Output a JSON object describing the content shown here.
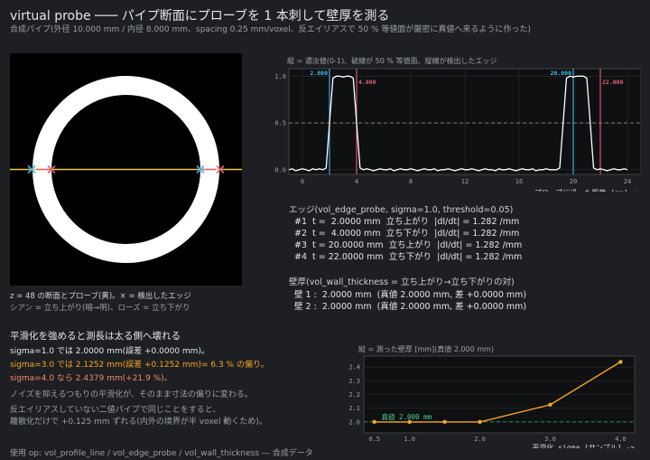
{
  "title": "virtual probe ─── パイプ断面にプローブを 1 本刺して壁厚を測る",
  "subtitle": "合成パイプ(外径 10.000 mm / 内径 8.000 mm、spacing 0.25 mm/voxel、反エイリアスで 50 % 等値面が厳密に真値へ来るように作った)",
  "slice": {
    "caption": "z = 48 の断面とプローブ(黄)。× = 検出したエッジ",
    "legend": "シアン = 立ち上がり(暗→明)、ローズ = 立ち下がり"
  },
  "colors": {
    "background": "#1e1f22",
    "plot_bg": "#0f1012",
    "probe": "#f2c94c",
    "rising": "#3fb8ea",
    "falling": "#e2607a",
    "profile": "#ffffff",
    "threshold": "#8a8d92",
    "thickness_line": "#f5a623",
    "truth_line": "#2f9e6b",
    "accent_text": "#f5a623",
    "accent_red": "#f08a6c"
  },
  "chart_data": [
    {
      "type": "line",
      "title": "縦 = 濃淡値(0-1)、破線が 50 % 等値面、縦線が検出したエッジ",
      "xlabel": "プローブに沿った距離 [mm] ->",
      "ylabel": "",
      "xlim": [
        -1,
        25
      ],
      "ylim": [
        -0.05,
        1.08
      ],
      "xticks": [
        0,
        4,
        8,
        12,
        16,
        20,
        24
      ],
      "xticklabels": [
        "0",
        "4",
        "8",
        "12",
        "16",
        "20",
        "24"
      ],
      "yticks": [
        0.0,
        0.5,
        1.0
      ],
      "yticklabels": [
        "0.0",
        "0.5",
        "1.0"
      ],
      "threshold": 0.5,
      "x": [
        -1.0,
        -0.75,
        -0.5,
        -0.25,
        0.0,
        0.25,
        0.5,
        0.75,
        1.0,
        1.25,
        1.5,
        1.75,
        2.0,
        2.25,
        2.5,
        2.75,
        3.0,
        3.25,
        3.5,
        3.75,
        4.0,
        4.25,
        4.5,
        4.75,
        5.0,
        5.25,
        5.5,
        5.75,
        6.0,
        6.25,
        6.5,
        6.75,
        7.0,
        7.25,
        7.5,
        7.75,
        8.0,
        8.25,
        8.5,
        8.75,
        9.0,
        9.25,
        9.5,
        9.75,
        10.0,
        10.25,
        10.5,
        10.75,
        11.0,
        11.25,
        11.5,
        11.75,
        12.0,
        12.25,
        12.5,
        12.75,
        13.0,
        13.25,
        13.5,
        13.75,
        14.0,
        14.25,
        14.5,
        14.75,
        15.0,
        15.25,
        15.5,
        15.75,
        16.0,
        16.25,
        16.5,
        16.75,
        17.0,
        17.25,
        17.5,
        17.75,
        18.0,
        18.25,
        18.5,
        18.75,
        19.0,
        19.25,
        19.5,
        19.75,
        20.0,
        20.25,
        20.5,
        20.75,
        21.0,
        21.25,
        21.5,
        21.75,
        22.0,
        22.25,
        22.5,
        22.75,
        23.0,
        23.25,
        23.5,
        23.75,
        24.0
      ],
      "y": [
        0.0,
        0.01,
        -0.01,
        0.0,
        0.01,
        0.0,
        -0.01,
        0.01,
        0.0,
        0.01,
        0.0,
        0.02,
        0.5,
        0.98,
        1.0,
        1.0,
        0.99,
        1.0,
        1.0,
        0.98,
        0.5,
        0.02,
        0.0,
        0.01,
        0.0,
        -0.01,
        0.0,
        0.01,
        0.0,
        0.0,
        0.01,
        -0.01,
        0.0,
        0.01,
        0.0,
        0.0,
        0.01,
        0.0,
        -0.01,
        0.0,
        0.01,
        0.0,
        0.0,
        0.01,
        -0.01,
        0.0,
        0.0,
        0.01,
        0.0,
        -0.01,
        0.0,
        0.01,
        0.0,
        0.0,
        0.01,
        0.0,
        -0.01,
        0.0,
        0.01,
        0.0,
        0.0,
        -0.01,
        0.01,
        0.0,
        0.0,
        0.01,
        0.0,
        -0.01,
        0.0,
        0.01,
        0.0,
        0.0,
        0.01,
        -0.01,
        0.0,
        0.0,
        0.01,
        0.0,
        0.0,
        0.0,
        0.02,
        0.5,
        0.98,
        1.0,
        0.99,
        1.0,
        1.0,
        1.0,
        0.98,
        0.5,
        0.02,
        0.0,
        0.01,
        0.0,
        -0.01,
        0.0,
        0.01,
        0.0,
        0.0,
        0.01,
        0.0
      ],
      "edges": [
        {
          "t": 2.0,
          "label": "2.000",
          "kind": "rising"
        },
        {
          "t": 4.0,
          "label": "4.000",
          "kind": "falling"
        },
        {
          "t": 20.0,
          "label": "20.000",
          "kind": "rising"
        },
        {
          "t": 22.0,
          "label": "22.000",
          "kind": "falling"
        }
      ]
    },
    {
      "type": "line",
      "title": "縦 = 測った壁厚 [mm](真値 2.000 mm)",
      "xlabel": "平滑化 sigma [サンプル] ->",
      "ylabel": "",
      "xlim": [
        0.35,
        4.2
      ],
      "ylim": [
        1.92,
        2.48
      ],
      "xticks": [
        0.5,
        1.0,
        2.0,
        3.0,
        4.0
      ],
      "xticklabels": [
        "0.5",
        "1.0",
        "2.0",
        "3.0",
        "4.0"
      ],
      "yticks": [
        2.0,
        2.1,
        2.2,
        2.3,
        2.4
      ],
      "yticklabels": [
        "2.0",
        "2.1",
        "2.2",
        "2.3",
        "2.4"
      ],
      "truth": 2.0,
      "truth_label": "真値 2.000 mm",
      "series": [
        {
          "x": [
            0.5,
            1.0,
            1.5,
            2.0,
            3.0,
            4.0
          ],
          "values": [
            2.0,
            2.0,
            2.0,
            2.0,
            2.1252,
            2.4379
          ]
        }
      ]
    }
  ],
  "edges_panel": {
    "heading": "エッジ(vol_edge_probe, sigma=1.0, threshold=0.05)",
    "rows": [
      "#1  t =  2.0000 mm  立ち上がり  |dI/dt| = 1.282 /mm",
      "#2  t =  4.0000 mm  立ち下がり  |dI/dt| = 1.282 /mm",
      "#3  t = 20.0000 mm  立ち上がり  |dI/dt| = 1.282 /mm",
      "#4  t = 22.0000 mm  立ち下がり  |dI/dt| = 1.282 /mm"
    ]
  },
  "walls_panel": {
    "heading": "壁厚(vol_wall_thickness = 立ち上がり→立ち下がりの対)",
    "rows": [
      "壁 1 :  2.0000 mm  (真値 2.0000 mm, 差 +0.0000 mm)",
      "壁 2 :  2.0000 mm  (真値 2.0000 mm, 差 +0.0000 mm)"
    ]
  },
  "notes": {
    "heading": "平滑化を強めると測長は太る側へ壊れる",
    "line1": "sigma=1.0 では 2.0000 mm(誤差 +0.0000 mm)。",
    "line2": "sigma=3.0 では 2.1252 mm(誤差 +0.1252 mm)= 6.3 % の偏り。",
    "line3": "sigma=4.0 なら 2.4379 mm(+21.9 %)。",
    "line4": "ノイズを抑えるつもりの平滑化が、そのまま寸法の偏りに変わる。",
    "line5": "反エイリアスしていない二値パイプで同じことをすると、",
    "line6": "離散化だけで +0.125 mm ずれる(内外の境界が半 voxel 動くため)。"
  },
  "footer": "使用 op: vol_profile_line / vol_edge_probe / vol_wall_thickness  ― 合成データ"
}
